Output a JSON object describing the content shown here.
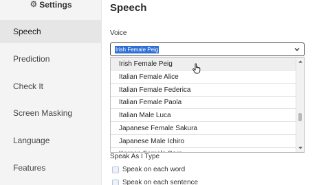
{
  "sidebar": {
    "title": "Settings",
    "items": [
      {
        "label": "Speech",
        "active": true
      },
      {
        "label": "Prediction"
      },
      {
        "label": "Check It"
      },
      {
        "label": "Screen Masking"
      },
      {
        "label": "Language"
      },
      {
        "label": "Features"
      }
    ]
  },
  "main": {
    "title": "Speech",
    "voice": {
      "label": "Voice",
      "selected": "Irish Female Peig",
      "options": [
        "Irish Female Peig",
        "Italian Female Alice",
        "Italian Female Federica",
        "Italian Female Paola",
        "Italian Male Luca",
        "Japanese Female Sakura",
        "Japanese Male Ichiro",
        "Korean Female Sora"
      ],
      "hovered_option": "Irish Female Peig"
    },
    "speak_as_i_type": {
      "label": "Speak As I Type",
      "options": [
        {
          "label": "Speak on each word",
          "checked": false
        },
        {
          "label": "Speak on each sentence",
          "checked": false
        }
      ]
    }
  },
  "colors": {
    "selection_highlight": "#2f6fd6",
    "sidebar_background": "#f4f4f4",
    "sidebar_active": "#e6e6e6"
  },
  "icons": {
    "sidebar_title": "gear-icon",
    "select": "chevron-down-icon",
    "cursor": "hand-pointer-icon"
  }
}
